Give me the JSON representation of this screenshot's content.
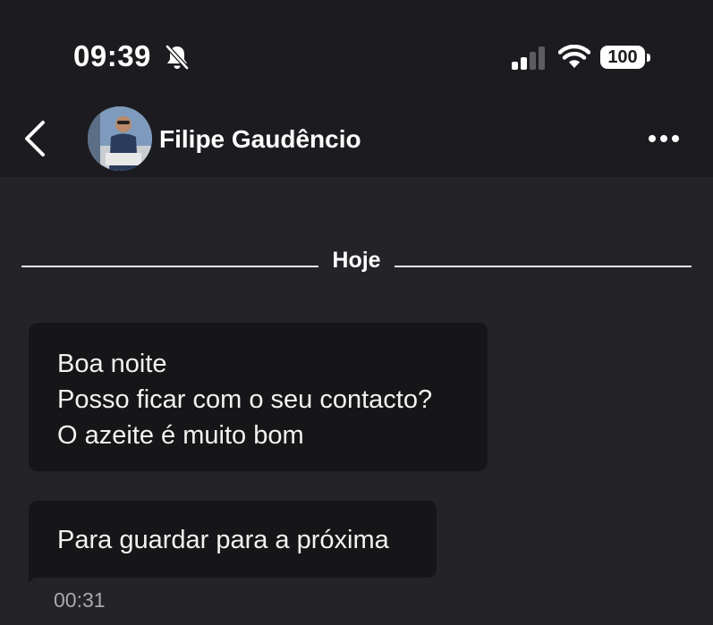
{
  "status_bar": {
    "time": "09:39",
    "silent_icon": "bell-slash-icon",
    "signal_icon": "cellular-signal-icon",
    "wifi_icon": "wifi-icon",
    "battery": "100"
  },
  "header": {
    "back_icon": "chevron-left-icon",
    "contact_name": "Filipe Gaudêncio",
    "more_icon": "more-horizontal-icon"
  },
  "chat": {
    "date_separator": "Hoje",
    "messages": [
      {
        "lines": [
          "Boa noite",
          "Posso ficar com o seu contacto?",
          "O azeite é muito bom"
        ]
      },
      {
        "lines": [
          "Para guardar para a próxima"
        ],
        "time": "00:31"
      }
    ]
  },
  "colors": {
    "background": "#232328",
    "header_background": "#1c1c20",
    "bubble": "#161619",
    "text": "#ffffff",
    "timestamp": "#a9a9ae"
  }
}
